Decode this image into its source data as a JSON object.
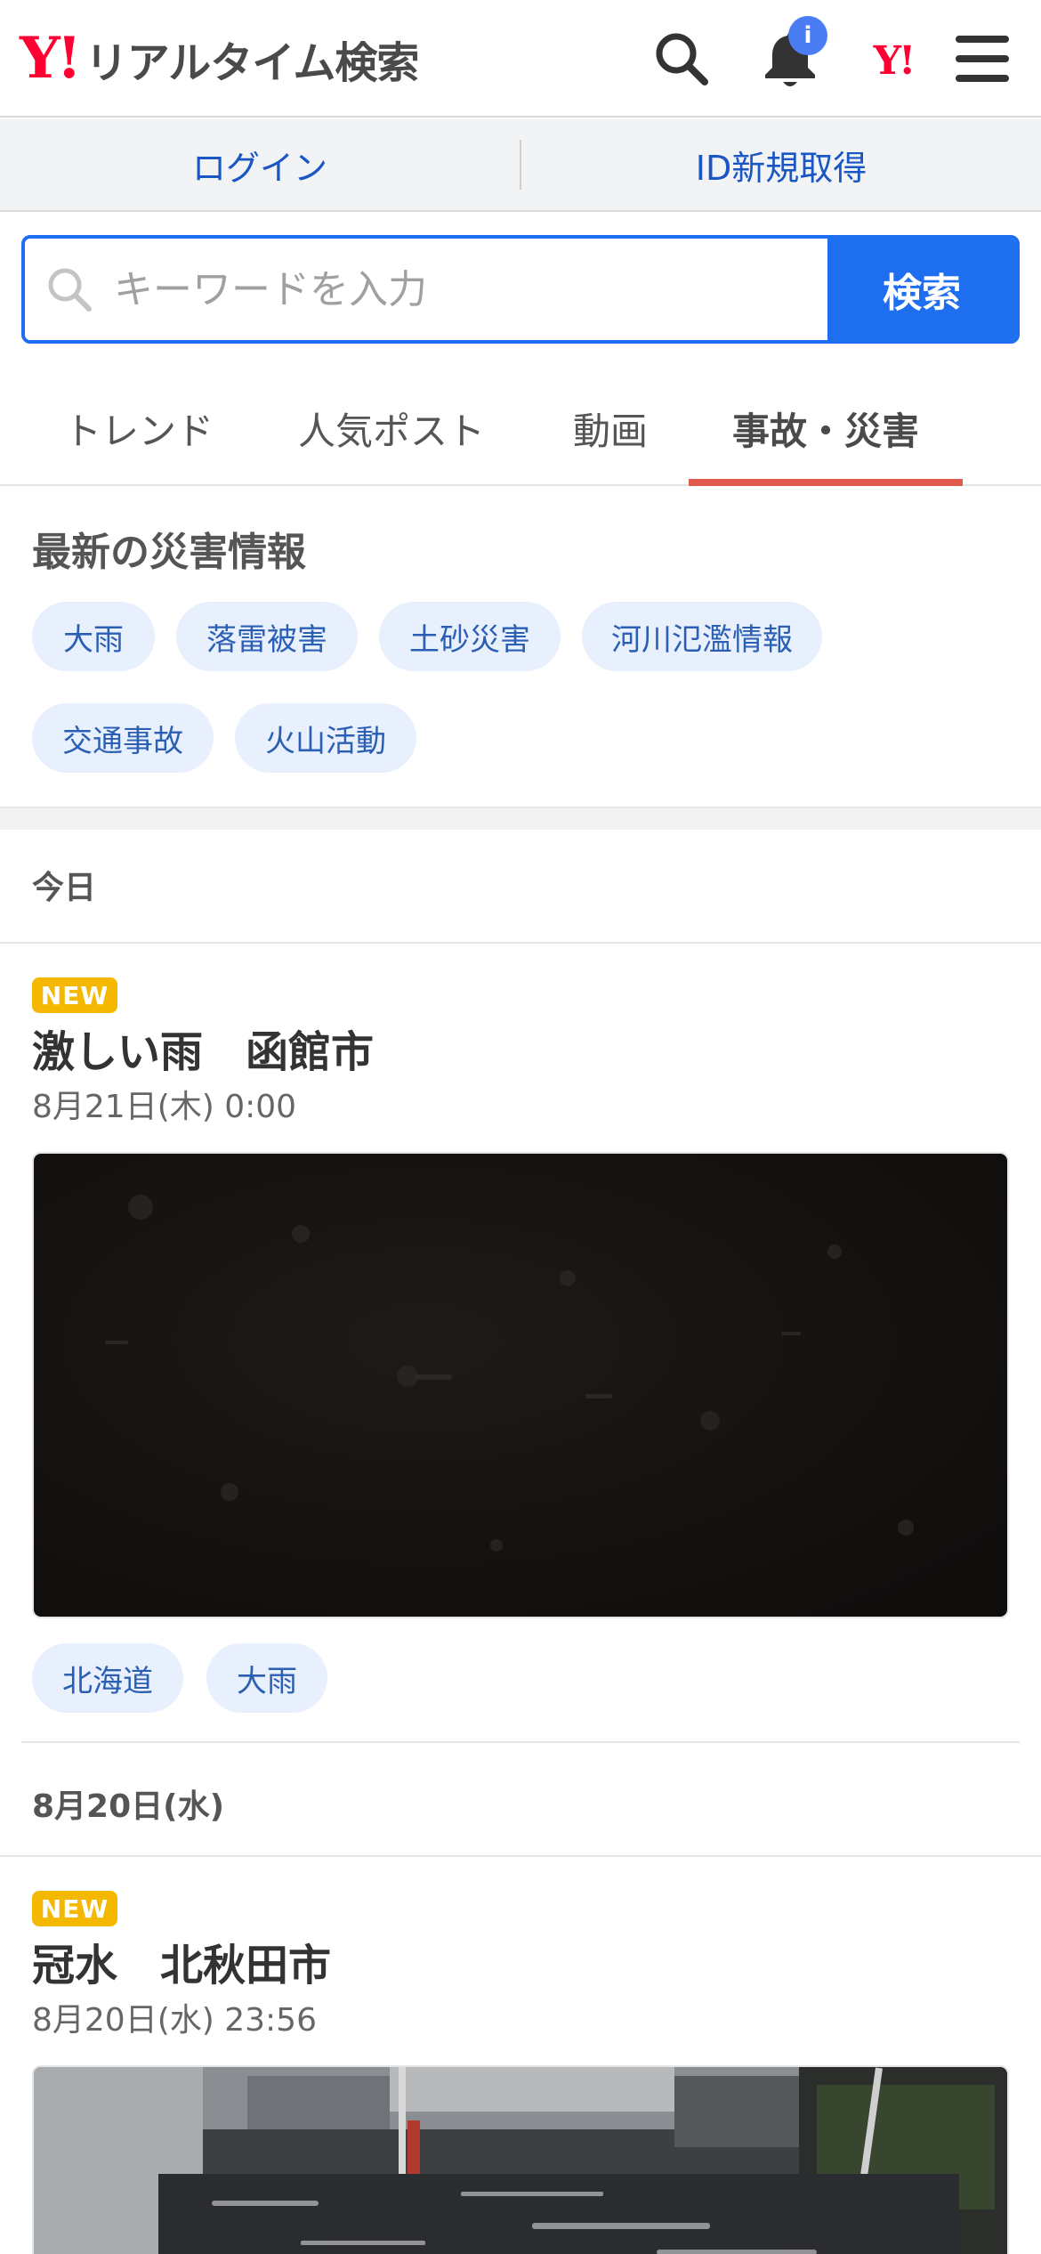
{
  "header": {
    "logo_mark": "Y!",
    "logo_text": "リアルタイム検索",
    "notification_badge": "i",
    "yahoo_mark": "Y!",
    "icons": [
      "search-icon",
      "bell-icon",
      "yahoo-logo-icon",
      "hamburger-menu-icon"
    ]
  },
  "loginbar": {
    "login": "ログイン",
    "register": "ID新規取得"
  },
  "search": {
    "placeholder": "キーワードを入力",
    "value": "",
    "button": "検索"
  },
  "tabs": [
    {
      "label": "トレンド",
      "active": false
    },
    {
      "label": "人気ポスト",
      "active": false
    },
    {
      "label": "動画",
      "active": false
    },
    {
      "label": "事故・災害",
      "active": true
    }
  ],
  "disaster": {
    "title": "最新の災害情報",
    "chips": [
      "大雨",
      "落雷被害",
      "土砂災害",
      "河川氾濫情報",
      "交通事故",
      "火山活動"
    ]
  },
  "feed": {
    "groups": [
      {
        "date_label": "今日",
        "articles": [
          {
            "badge": "NEW",
            "title": "激しい雨　函館市",
            "time": "8月21日(木) 0:00",
            "tags": [
              "北海道",
              "大雨"
            ]
          }
        ]
      },
      {
        "date_label": "8月20日(水)",
        "articles": [
          {
            "badge": "NEW",
            "title": "冠水　北秋田市",
            "time": "8月20日(水) 23:56"
          }
        ]
      }
    ]
  },
  "colors": {
    "yahoo_red": "#ff0033",
    "accent_blue": "#1e6ef0",
    "link_blue": "#1a56c4",
    "chip_bg": "#e8f0fd",
    "active_tab_underline": "#e05a4e",
    "new_badge": "#f5b800"
  }
}
